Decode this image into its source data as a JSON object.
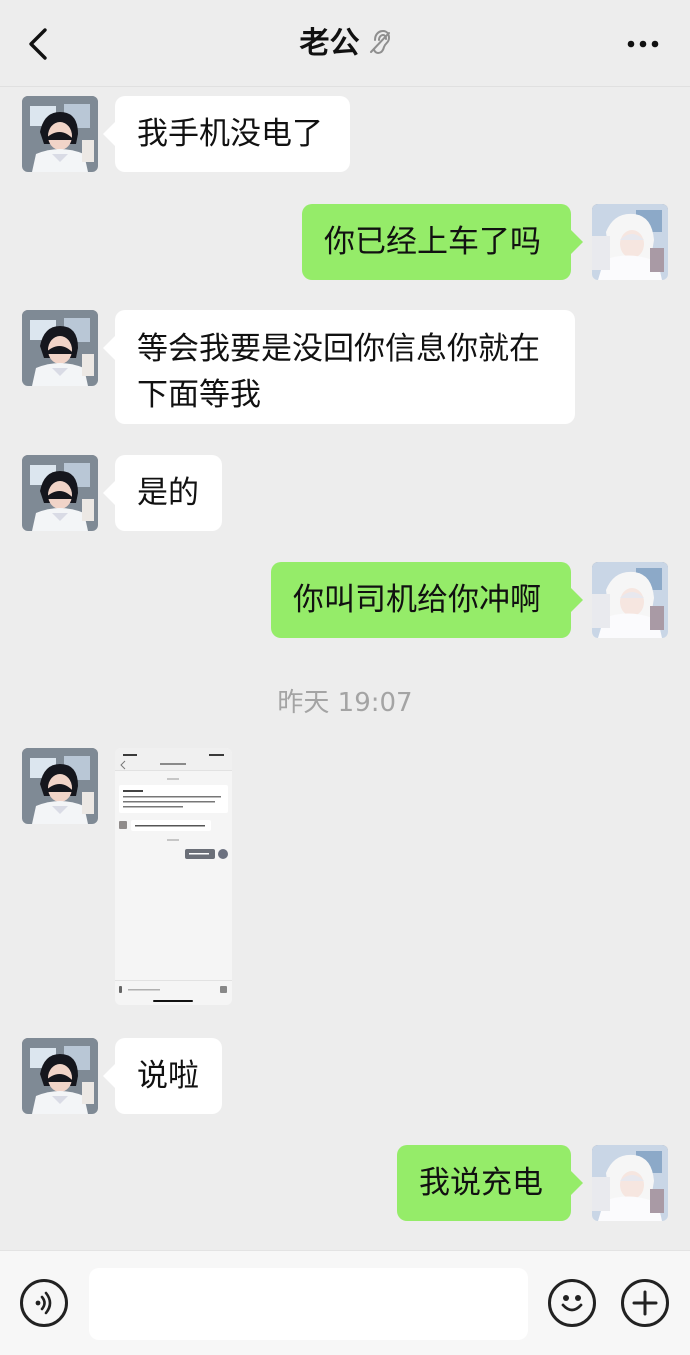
{
  "header": {
    "title": "老公",
    "back_icon": "chevron-left-icon",
    "mute_icon": "ear-icon",
    "more_icon": "more-dots-icon"
  },
  "messages": [
    {
      "side": "left",
      "text": "我手机没电了"
    },
    {
      "side": "right",
      "text": "你已经上车了吗"
    },
    {
      "side": "left",
      "text": "等会我要是没回你信息你就在下面等我"
    },
    {
      "side": "left",
      "text": "是的"
    },
    {
      "side": "right",
      "text": "你叫司机给你冲啊"
    },
    {
      "timestamp": "昨天 19:07"
    },
    {
      "side": "left",
      "type": "image"
    },
    {
      "side": "left",
      "text": "说啦"
    },
    {
      "side": "right",
      "text": "我说充电"
    }
  ],
  "input_bar": {
    "voice_icon": "voice-icon",
    "emoji_icon": "emoji-icon",
    "plus_icon": "plus-icon",
    "placeholder": ""
  },
  "colors": {
    "background": "#ededed",
    "sent_bubble": "#95ec69",
    "received_bubble": "#ffffff",
    "timestamp_text": "#a4a4a4"
  }
}
